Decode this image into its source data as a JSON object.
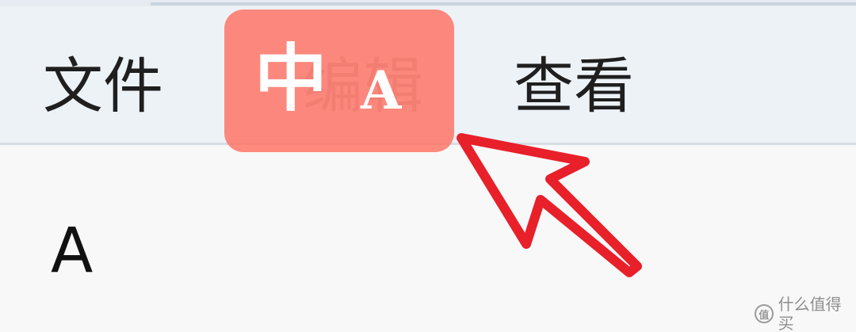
{
  "menubar": {
    "items": [
      {
        "label": "文件"
      },
      {
        "label": "编辑"
      },
      {
        "label": "查看"
      }
    ]
  },
  "ime_indicator": {
    "mode": "中",
    "letter": "A",
    "color": "#ff7062"
  },
  "content": {
    "letter": "A"
  },
  "annotation": {
    "arrow_icon": "red-outline-arrow-icon",
    "color": "#e8202a"
  },
  "watermark": {
    "icon_glyph": "值",
    "text": "什么值得买"
  }
}
